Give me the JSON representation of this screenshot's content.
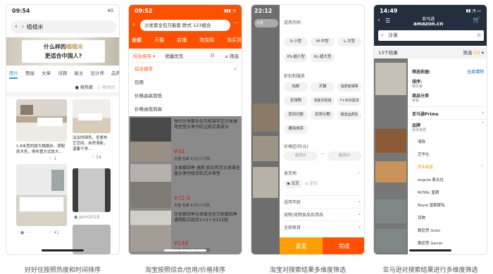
{
  "p1": {
    "time": "09:54",
    "net": "4G",
    "search": "榻榻米",
    "banner1": "什么样的",
    "banner_hl": "榻榻米",
    "banner2": "更适合中国人?",
    "tabs": [
      "图片",
      "整屋",
      "文章",
      "话题",
      "屋主",
      "设计师",
      "品牌"
    ],
    "sort_hot": "按热度",
    "sort_time": "按时间",
    "c1_title": "1.8米宽的超大榻榻米，搭配原木色，将布置方式放大...",
    "c1_likes": "1",
    "c2_title": "淡淡的绿色，全是布艺空间，自然清新，温馨干净...",
    "c2_likes": "54",
    "c3_likes": "41",
    "c4_user": "Jerm2018"
  },
  "p2": {
    "time": "09:52",
    "search": "沙发套全包万能套 欧式 123组合",
    "tabs": [
      "全部",
      "天猫",
      "店铺",
      "淘宝网",
      "淘买货"
    ],
    "sort": [
      "综合排序",
      "销量优先"
    ],
    "filter": "筛选",
    "options": [
      "综合排序",
      "信用",
      "价格由高到低",
      "价格由低到高"
    ],
    "items": [
      {
        "title": "弹力沙发套全包万能罩布艺沙发通用坐垫沙发巾防尘欧式真皮沙",
        "price": "34",
        "tag": "天猫"
      },
      {
        "title": "沙发套四季 通用 欧式布艺沙发罩全盖沙发巾组合轮式沙发垫",
        "price": "72.4",
        "tag": "天猫"
      },
      {
        "title": "沙发套四季沙发套全包万能套四季通用欧式组合1+2+3/123组",
        "price": "148",
        "tag": "天猫"
      }
    ],
    "price_unit": "¥",
    "meta": "包邮 9.0万人付款"
  },
  "p3": {
    "time": "22:12",
    "groups": [
      {
        "title": "适用尺码",
        "chips": [
          "S-小型",
          "M-中型",
          "L-大型",
          "XS-超小型",
          "XL-超大型"
        ]
      },
      {
        "title": "折扣和服务",
        "chips": [
          "包邮",
          "天猫",
          "消费者保障",
          "全球购",
          "淘金币抵钱",
          "7+天内退货",
          "货到付款",
          "花呗分期",
          "赠送运费险",
          "通用",
          "通用排序"
        ]
      }
    ],
    "price_title": "价格区间(元)",
    "price_min": "最低价",
    "price_max": "最高价",
    "ship_title": "发货地",
    "ship_opts": [
      "北京",
      "定位"
    ],
    "rows": [
      "适用年龄",
      "宠物/宠物食品及用品",
      "全部类目"
    ],
    "reset": "重置",
    "done": "完成",
    "bg_search": "沙发"
  },
  "p4": {
    "time": "14:49",
    "logo": "亚马逊",
    "logo_sub": "amazon.cn",
    "search": "沙发",
    "results": "13个结果",
    "filter": "筛选",
    "filter_count": "(1)",
    "panel_title": "筛选依据:",
    "clear_all": "全部清除",
    "sort_label": "排序:",
    "sort_val": "相关度",
    "ship_label": "商品分类",
    "ship_val": "家装",
    "prime": "亚马逊Prime",
    "brand": "品牌",
    "brand_sub": "拜禾家居",
    "brands": [
      "清除",
      "芝华仕",
      "拜禾家居",
      "aogula 奥古拉",
      "ROYAL 皇朝",
      "Royal 皇朝家私",
      "百物",
      "歌尼思 Gnisi",
      "歌尼思 Genisi"
    ]
  },
  "captions": [
    "好好住按照热度和时间排序",
    "淘宝按照综合/信用/价格排序",
    "淘宝对搜索结果多维度筛选",
    "亚马逊对搜索结果进行多维度筛选"
  ],
  "colors": {
    "accent1": "#2a9fd6",
    "accent2": "#ff5000",
    "accent3": "#ff7a00",
    "amazon": "#232f3e",
    "orange": "#f49b00"
  }
}
